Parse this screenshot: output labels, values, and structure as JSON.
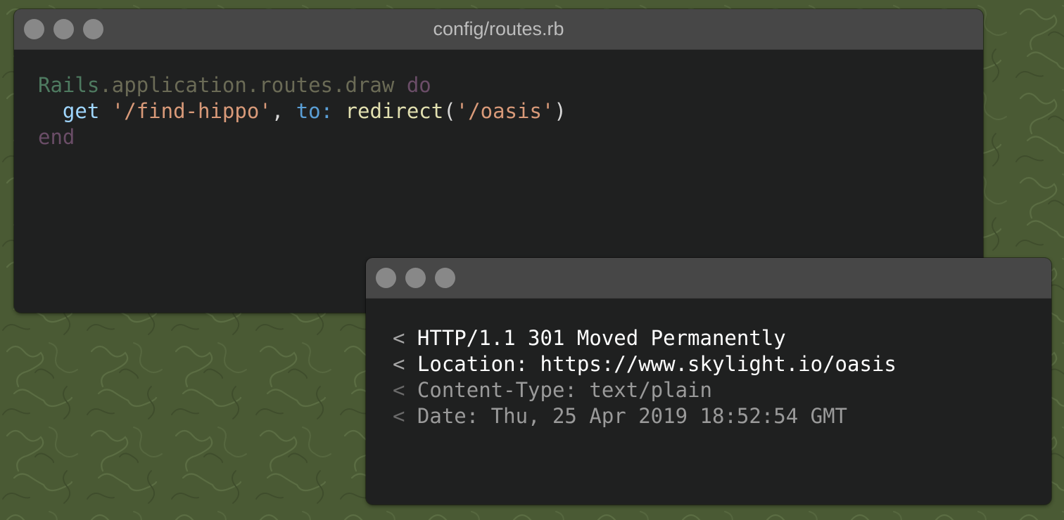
{
  "colors": {
    "background": "#4a5a34",
    "window_body": "#1f2020",
    "titlebar": "#474747",
    "traffic_dot": "#888888"
  },
  "editor": {
    "title": "config/routes.rb",
    "lines": [
      [
        {
          "text": "Rails",
          "role": "const"
        },
        {
          "text": ".application.routes.draw ",
          "role": "dim"
        },
        {
          "text": "do",
          "role": "kw"
        }
      ],
      [
        {
          "text": "  ",
          "role": "punct"
        },
        {
          "text": "get",
          "role": "meth"
        },
        {
          "text": " ",
          "role": "punct"
        },
        {
          "text": "'/find-hippo'",
          "role": "str"
        },
        {
          "text": ", ",
          "role": "punct"
        },
        {
          "text": "to:",
          "role": "sym"
        },
        {
          "text": " ",
          "role": "punct"
        },
        {
          "text": "redirect",
          "role": "call"
        },
        {
          "text": "(",
          "role": "punct"
        },
        {
          "text": "'/oasis'",
          "role": "str"
        },
        {
          "text": ")",
          "role": "punct"
        }
      ],
      [
        {
          "text": "end",
          "role": "kw"
        }
      ]
    ]
  },
  "terminal": {
    "title": "",
    "lines": [
      {
        "prompt": "< ",
        "text": "HTTP/1.1 301 Moved Permanently",
        "emphasis": "high"
      },
      {
        "prompt": "< ",
        "text": "Location: https://www.skylight.io/oasis",
        "emphasis": "high"
      },
      {
        "prompt": "< ",
        "text": "Content-Type: text/plain",
        "emphasis": "low"
      },
      {
        "prompt": "< ",
        "text": "Date: Thu, 25 Apr 2019 18:52:54 GMT",
        "emphasis": "low"
      }
    ]
  }
}
